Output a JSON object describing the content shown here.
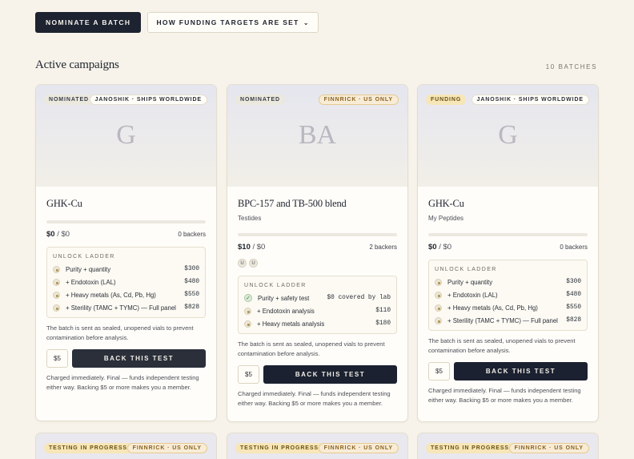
{
  "toolbar": {
    "nominate_label": "NOMINATE A BATCH",
    "funding_label": "HOW FUNDING TARGETS ARE SET",
    "funding_chevron": "⌄"
  },
  "section": {
    "title": "Active campaigns",
    "count": "10 BATCHES"
  },
  "cards": [
    {
      "status": "NOMINATED",
      "shipping": "JANOSHIK · SHIPS WORLDWIDE",
      "initials": "G",
      "name": "GHK-Cu",
      "vendor": "",
      "raised": "$0",
      "goal": " / $0",
      "backers": "0 backers",
      "ladder_title": "UNLOCK LADDER",
      "rungs": [
        {
          "label": "Purity + quantity",
          "price": "$300",
          "state": "locked"
        },
        {
          "label": "+ Endotoxin (LAL)",
          "price": "$480",
          "state": "locked"
        },
        {
          "label": "+ Heavy metals (As, Cd, Pb, Hg)",
          "price": "$550",
          "state": "locked"
        },
        {
          "label": "+ Sterility (TAMC + TYMC) — Full panel",
          "price": "$828",
          "state": "locked"
        }
      ],
      "note": "The batch is sent as sealed, unopened vials to prevent contamination before analysis.",
      "amount": "$5",
      "back_label": "BACK THIS TEST",
      "charge": "Charged immediately. Final — funds independent testing either way. Backing $5 or more makes you a member."
    },
    {
      "status": "NOMINATED",
      "shipping": "FINNRICK · US ONLY",
      "initials": "BA",
      "name": "BPC-157 and TB-500 blend",
      "vendor": "Testides",
      "raised": "$10",
      "goal": " / $0",
      "backers": "2 backers",
      "avatars": [
        "U",
        "U"
      ],
      "ladder_title": "UNLOCK LADDER",
      "rungs": [
        {
          "label": "Purity + safety test",
          "price": "$0 covered by lab",
          "state": "unlocked"
        },
        {
          "label": "+ Endotoxin analysis",
          "price": "$110",
          "state": "locked"
        },
        {
          "label": "+ Heavy metals analysis",
          "price": "$180",
          "state": "locked"
        }
      ],
      "note": "The batch is sent as sealed, unopened vials to prevent contamination before analysis.",
      "amount": "$5",
      "back_label": "BACK THIS TEST",
      "charge": "Charged immediately. Final — funds independent testing either way. Backing $5 or more makes you a member."
    },
    {
      "status": "FUNDING",
      "shipping": "JANOSHIK · SHIPS WORLDWIDE",
      "initials": "G",
      "name": "GHK-Cu",
      "vendor": "My Peptides",
      "raised": "$0",
      "goal": " / $0",
      "backers": "0 backers",
      "ladder_title": "UNLOCK LADDER",
      "rungs": [
        {
          "label": "Purity + quantity",
          "price": "$300",
          "state": "locked"
        },
        {
          "label": "+ Endotoxin (LAL)",
          "price": "$480",
          "state": "locked"
        },
        {
          "label": "+ Heavy metals (As, Cd, Pb, Hg)",
          "price": "$550",
          "state": "locked"
        },
        {
          "label": "+ Sterility (TAMC + TYMC) — Full panel",
          "price": "$828",
          "state": "locked"
        }
      ],
      "note": "The batch is sent as sealed, unopened vials to prevent contamination before analysis.",
      "amount": "$5",
      "back_label": "BACK THIS TEST",
      "charge": "Charged immediately. Final — funds independent testing either way. Backing $5 or more makes you a member."
    }
  ],
  "bottom_cards": [
    {
      "status": "TESTING IN PROGRESS",
      "shipping": "FINNRICK · US ONLY"
    },
    {
      "status": "TESTING IN PROGRESS",
      "shipping": "FINNRICK · US ONLY"
    },
    {
      "status": "TESTING IN PROGRESS",
      "shipping": "FINNRICK · US ONLY"
    }
  ]
}
